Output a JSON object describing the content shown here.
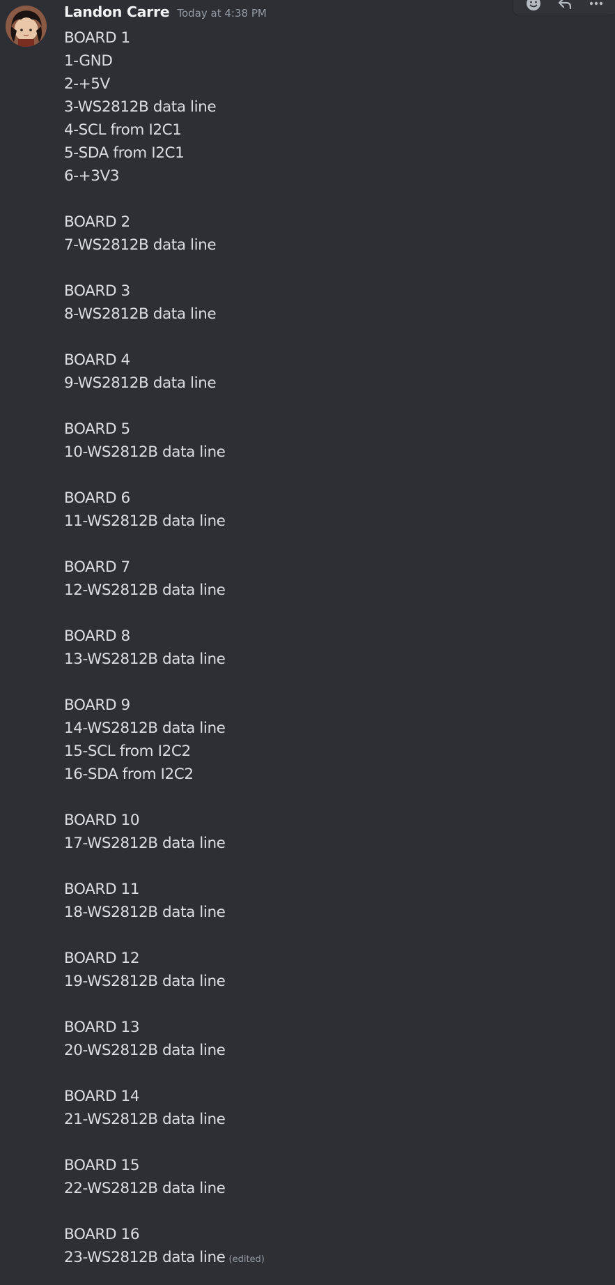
{
  "message": {
    "author": "Landon Carre",
    "timestamp": "Today at 4:38 PM",
    "edited_label": "(edited)",
    "lines": [
      "BOARD 1",
      "1-GND",
      "2-+5V",
      "3-WS2812B data line",
      "4-SCL from I2C1",
      "5-SDA from I2C1",
      "6-+3V3",
      "",
      "BOARD 2",
      "7-WS2812B data line",
      "",
      "BOARD 3",
      "8-WS2812B data line",
      "",
      "BOARD 4",
      "9-WS2812B data line",
      "",
      "BOARD 5",
      "10-WS2812B data line",
      "",
      "BOARD 6",
      "11-WS2812B data line",
      "",
      "BOARD 7",
      "12-WS2812B data line",
      "",
      "BOARD 8",
      "13-WS2812B data line",
      "",
      "BOARD 9",
      "14-WS2812B data line",
      "15-SCL from I2C2",
      "16-SDA from I2C2",
      "",
      "BOARD 10",
      "17-WS2812B data line",
      "",
      "BOARD 11",
      "18-WS2812B data line",
      "",
      "BOARD 12",
      "19-WS2812B data line",
      "",
      "BOARD 13",
      "20-WS2812B data line",
      "",
      "BOARD 14",
      "21-WS2812B data line",
      "",
      "BOARD 15",
      "22-WS2812B data line",
      "",
      "BOARD 16",
      "23-WS2812B data line"
    ]
  },
  "toolbar": {
    "icons": [
      "emoji-icon",
      "reply-icon",
      "more-icon"
    ]
  },
  "colors": {
    "background": "#2e2f34",
    "username": "#f2f3f5",
    "text": "#dbdee1",
    "muted": "#949ba4"
  }
}
